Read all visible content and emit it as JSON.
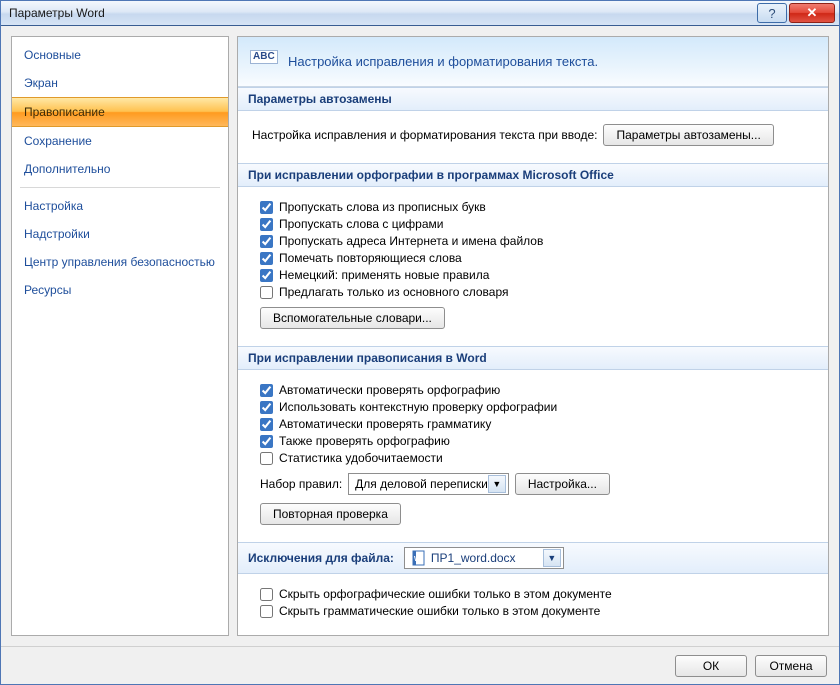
{
  "window": {
    "title": "Параметры Word"
  },
  "sidebar": {
    "items": [
      {
        "label": "Основные"
      },
      {
        "label": "Экран"
      },
      {
        "label": "Правописание",
        "selected": true
      },
      {
        "label": "Сохранение"
      },
      {
        "label": "Дополнительно"
      },
      {
        "label": "Настройка"
      },
      {
        "label": "Надстройки"
      },
      {
        "label": "Центр управления безопасностью"
      },
      {
        "label": "Ресурсы"
      }
    ]
  },
  "header": {
    "title": "Настройка исправления и форматирования текста."
  },
  "sections": {
    "autocorrect": {
      "title": "Параметры автозамены",
      "desc": "Настройка исправления и форматирования текста при вводе:",
      "button": "Параметры автозамены..."
    },
    "spelling_office": {
      "title": "При исправлении орфографии в программах Microsoft Office",
      "checks": [
        {
          "label": "Пропускать слова из прописных букв",
          "checked": true
        },
        {
          "label": "Пропускать слова с цифрами",
          "checked": true
        },
        {
          "label": "Пропускать адреса Интернета и имена файлов",
          "checked": true
        },
        {
          "label": "Помечать повторяющиеся слова",
          "checked": true
        },
        {
          "label": "Немецкий: применять новые правила",
          "checked": true
        },
        {
          "label": "Предлагать только из основного словаря",
          "checked": false
        }
      ],
      "button": "Вспомогательные словари..."
    },
    "spelling_word": {
      "title": "При исправлении правописания в Word",
      "checks": [
        {
          "label": "Автоматически проверять орфографию",
          "checked": true
        },
        {
          "label": "Использовать контекстную проверку орфографии",
          "checked": true
        },
        {
          "label": "Автоматически проверять грамматику",
          "checked": true
        },
        {
          "label": "Также проверять орфографию",
          "checked": true
        },
        {
          "label": "Статистика удобочитаемости",
          "checked": false
        }
      ],
      "ruleset_label": "Набор правил:",
      "ruleset_value": "Для деловой переписки",
      "settings_button": "Настройка...",
      "recheck_button": "Повторная проверка"
    },
    "exceptions": {
      "title": "Исключения для файла:",
      "file": "ПР1_word.docx",
      "checks": [
        {
          "label": "Скрыть орфографические ошибки только в этом документе",
          "checked": false
        },
        {
          "label": "Скрыть грамматические ошибки только в этом документе",
          "checked": false
        }
      ]
    }
  },
  "footer": {
    "ok": "ОК",
    "cancel": "Отмена"
  }
}
